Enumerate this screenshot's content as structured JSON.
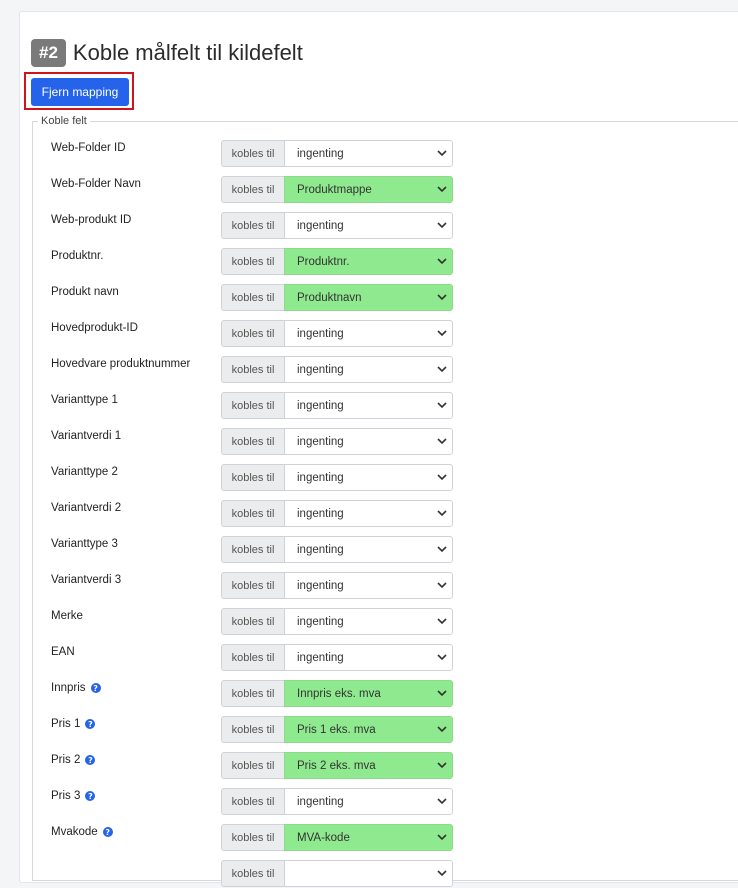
{
  "header": {
    "step": "#2",
    "title": "Koble målfelt til kildefelt"
  },
  "actions": {
    "remove_mapping": "Fjern mapping"
  },
  "mapping": {
    "legend": "Koble felt",
    "addon_label": "kobles til",
    "rows": [
      {
        "label": "Web-Folder ID",
        "value": "ingenting",
        "mapped": false,
        "help": false
      },
      {
        "label": "Web-Folder Navn",
        "value": "Produktmappe",
        "mapped": true,
        "help": false
      },
      {
        "label": "Web-produkt ID",
        "value": "ingenting",
        "mapped": false,
        "help": false
      },
      {
        "label": "Produktnr.",
        "value": "Produktnr.",
        "mapped": true,
        "help": false
      },
      {
        "label": "Produkt navn",
        "value": "Produktnavn",
        "mapped": true,
        "help": false
      },
      {
        "label": "Hovedprodukt-ID",
        "value": "ingenting",
        "mapped": false,
        "help": false
      },
      {
        "label": "Hovedvare produktnummer",
        "value": "ingenting",
        "mapped": false,
        "help": false
      },
      {
        "label": "Varianttype 1",
        "value": "ingenting",
        "mapped": false,
        "help": false
      },
      {
        "label": "Variantverdi 1",
        "value": "ingenting",
        "mapped": false,
        "help": false
      },
      {
        "label": "Varianttype 2",
        "value": "ingenting",
        "mapped": false,
        "help": false
      },
      {
        "label": "Variantverdi 2",
        "value": "ingenting",
        "mapped": false,
        "help": false
      },
      {
        "label": "Varianttype 3",
        "value": "ingenting",
        "mapped": false,
        "help": false
      },
      {
        "label": "Variantverdi 3",
        "value": "ingenting",
        "mapped": false,
        "help": false
      },
      {
        "label": "Merke",
        "value": "ingenting",
        "mapped": false,
        "help": false
      },
      {
        "label": "EAN",
        "value": "ingenting",
        "mapped": false,
        "help": false
      },
      {
        "label": "Innpris",
        "value": "Innpris eks. mva",
        "mapped": true,
        "help": true
      },
      {
        "label": "Pris 1",
        "value": "Pris 1 eks. mva",
        "mapped": true,
        "help": true
      },
      {
        "label": "Pris 2",
        "value": "Pris 2 eks. mva",
        "mapped": true,
        "help": true
      },
      {
        "label": "Pris 3",
        "value": "ingenting",
        "mapped": false,
        "help": true
      },
      {
        "label": "Mvakode",
        "value": "MVA-kode",
        "mapped": true,
        "help": true
      },
      {
        "label": "",
        "value": "",
        "mapped": false,
        "help": false
      }
    ]
  },
  "colors": {
    "primary": "#2563eb",
    "mapped_bg": "#8fe98f",
    "highlight": "#d0141b",
    "badge": "#7a7a7a"
  },
  "icons": {
    "help": "question-circle-icon",
    "dropdown": "chevron-down-icon"
  }
}
